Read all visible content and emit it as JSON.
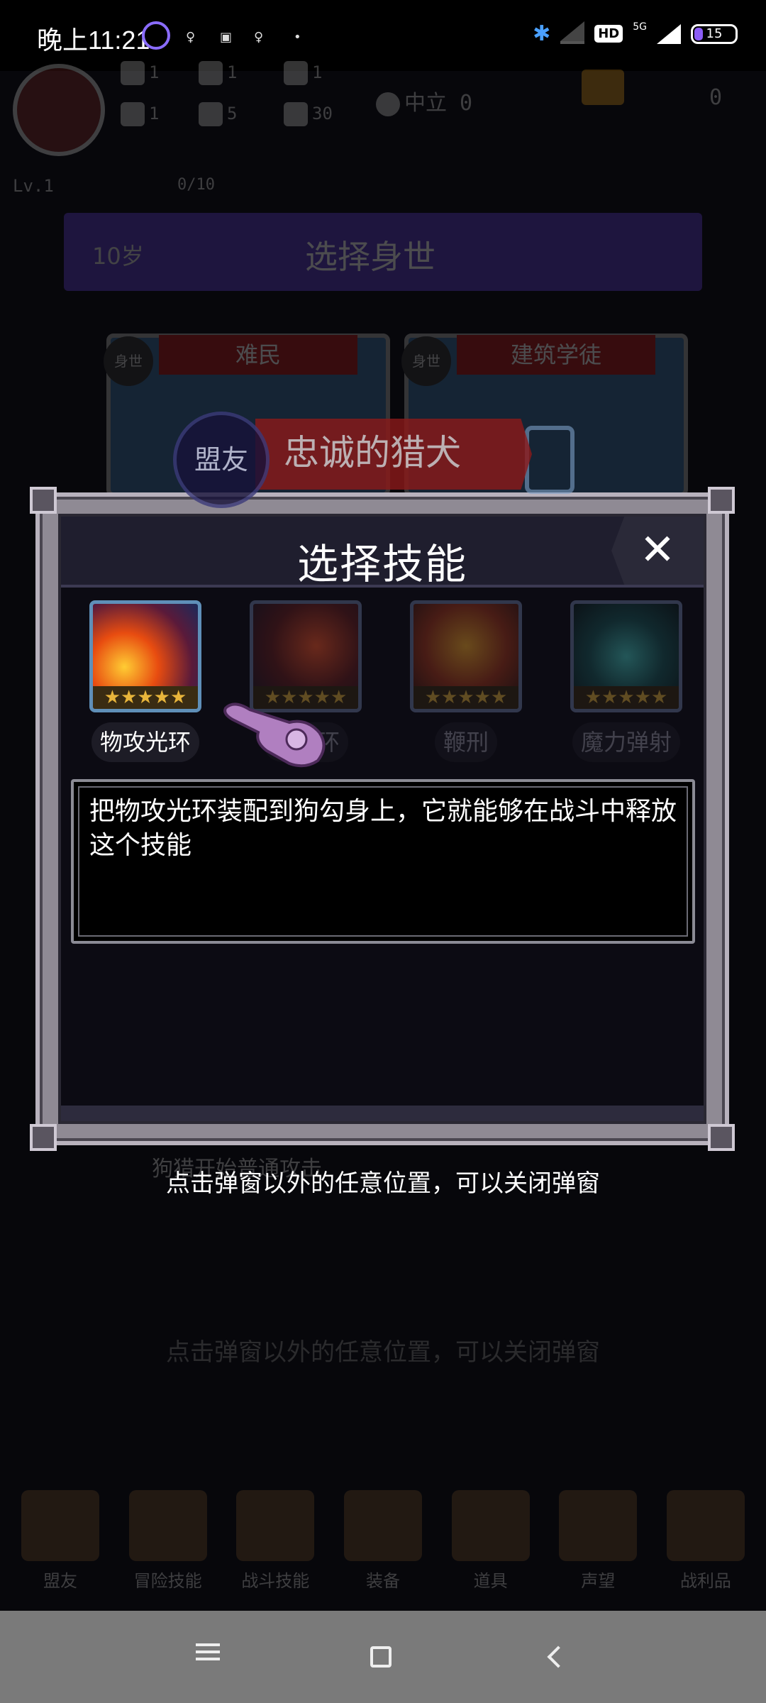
{
  "status_bar": {
    "time": "晚上11:21",
    "battery": "15",
    "network": "5G",
    "hd_badge": "HD"
  },
  "game_header": {
    "stats": [
      {
        "icon": "fist-icon",
        "value": "1"
      },
      {
        "icon": "scroll-icon",
        "value": "1"
      },
      {
        "icon": "wizard-hat-icon",
        "value": "1"
      },
      {
        "icon": "clover-icon",
        "value": "1"
      },
      {
        "icon": "book-icon",
        "value": "5"
      },
      {
        "icon": "flame-icon",
        "value": "30"
      }
    ],
    "alignment": "中立 0",
    "gold": "0",
    "level": "Lv.1",
    "xp": "0/10"
  },
  "background": {
    "age": "10岁",
    "banner_title": "选择身世",
    "card_tag": "身世",
    "card_left": "难民",
    "card_right": "建筑学徒",
    "ally_tag": "盟友",
    "ally_name": "忠诚的猎犬",
    "lower_hint": "点击弹窗以外的任意位置，可以关闭弹窗",
    "ghost_text": "狗猎开始普通攻击"
  },
  "bottom_nav": [
    {
      "label": "盟友",
      "icon": "ally-icon"
    },
    {
      "label": "冒险技能",
      "icon": "adventure-skill-icon"
    },
    {
      "label": "战斗技能",
      "icon": "combat-skill-icon"
    },
    {
      "label": "装备",
      "icon": "equipment-icon"
    },
    {
      "label": "道具",
      "icon": "items-icon"
    },
    {
      "label": "声望",
      "icon": "reputation-icon"
    },
    {
      "label": "战利品",
      "icon": "loot-icon"
    }
  ],
  "modal": {
    "title": "选择技能",
    "close_symbol": "✕",
    "skills": [
      {
        "label": "物攻光环",
        "selected": true,
        "stars": "★★★★★"
      },
      {
        "label": "魔攻光环",
        "visible_label": "魔光环",
        "selected": false,
        "stars": "★★★★★"
      },
      {
        "label": "鞭刑",
        "selected": false,
        "stars": "★★★★★"
      },
      {
        "label": "魔力弹射",
        "selected": false,
        "stars": "★★★★★"
      }
    ],
    "description": "把物攻光环装配到狗勾身上，它就能够在战斗中释放这个技能",
    "hint": "点击弹窗以外的任意位置，可以关闭弹窗"
  },
  "colors": {
    "accent_star": "#e8b53b",
    "ally_red": "#8c1919",
    "modal_frame": "#8f8a94"
  }
}
